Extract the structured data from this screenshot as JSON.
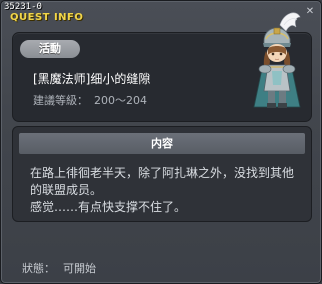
{
  "window": {
    "quest_id": "35231-0",
    "title": "QUEST INFO",
    "close_glyph": "✕"
  },
  "quest": {
    "category": "活動",
    "name": "[黑魔法师]细小的缝隙",
    "level_label": "建議等級：",
    "level_value": "200～204",
    "portrait_icon": "knight-portrait-icon"
  },
  "content": {
    "header": "内容",
    "lines": [
      "在路上徘徊老半天，除了阿扎琳之外，没找到其他的联盟成员。",
      "感觉……有点快支撑不住了。"
    ]
  },
  "status": {
    "label": "狀態：",
    "value": "可開始"
  },
  "colors": {
    "title": "#f2d64a",
    "panel": "#272a30",
    "header_bar": "#626770"
  }
}
